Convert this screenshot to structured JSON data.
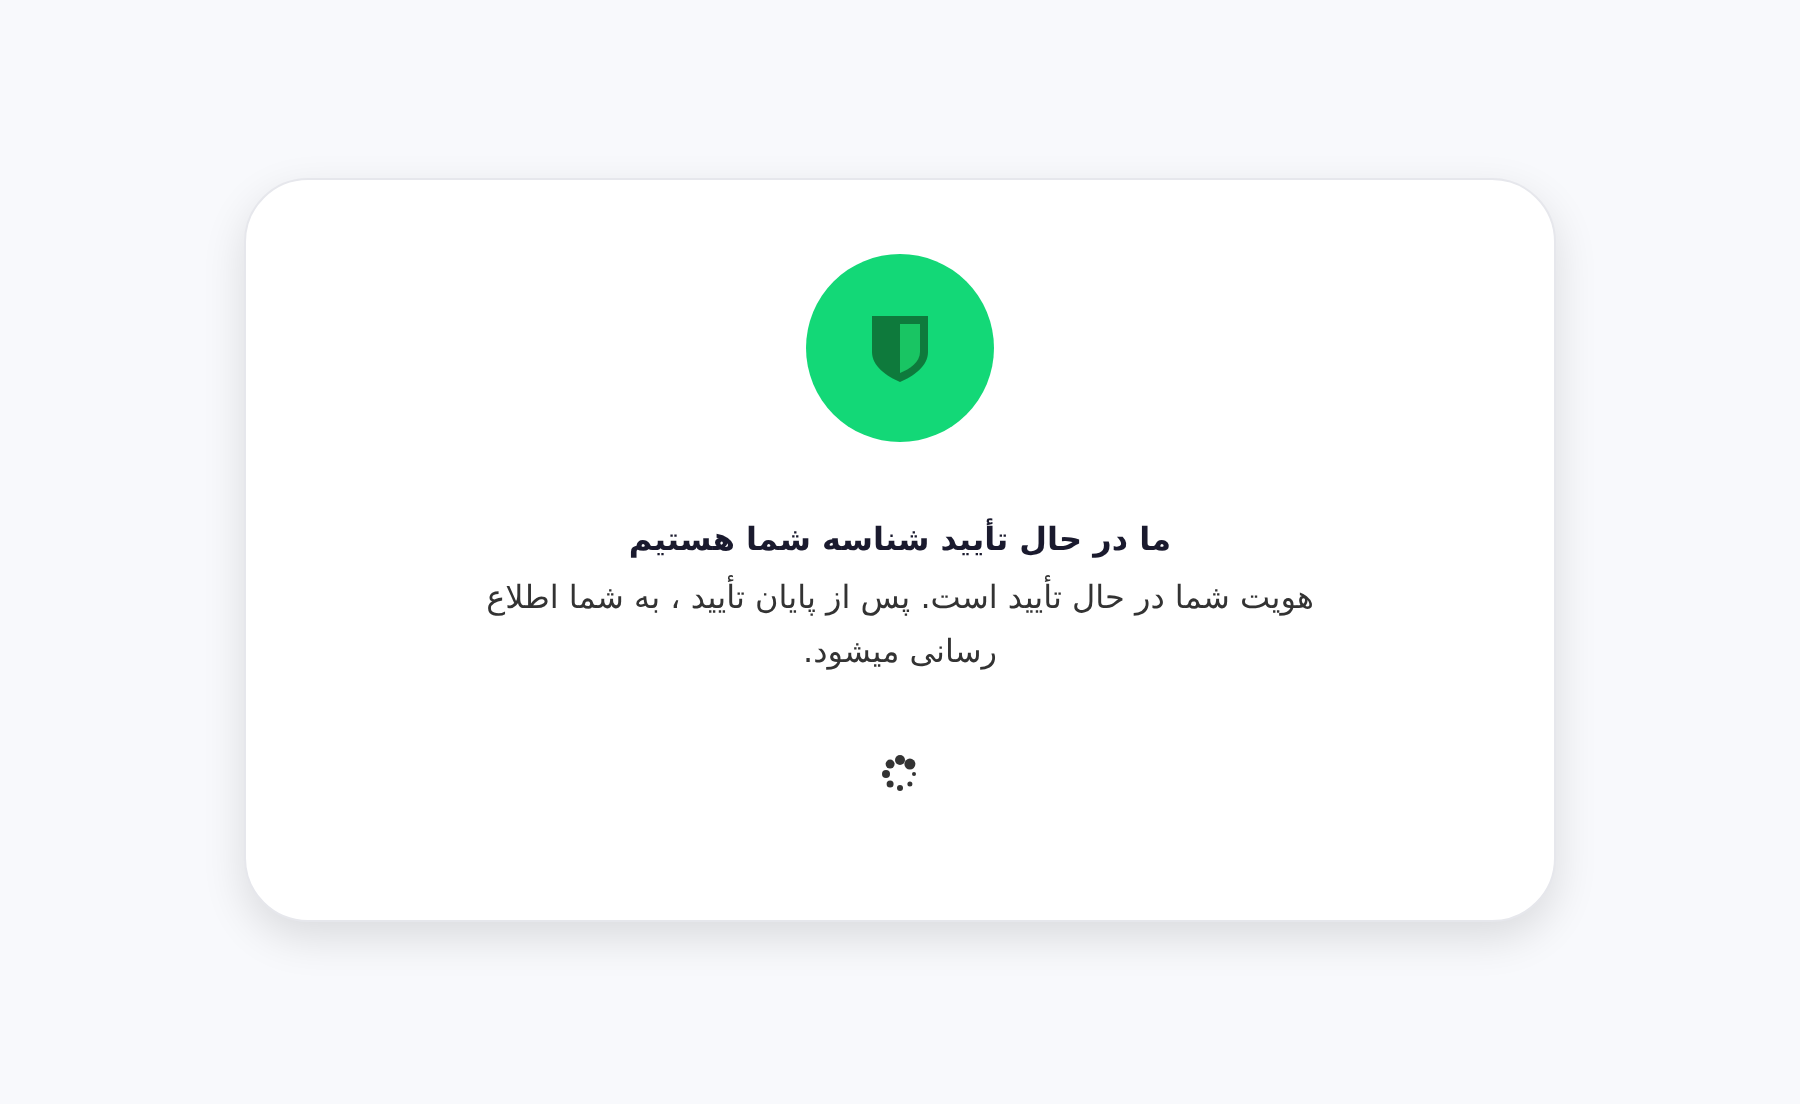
{
  "card": {
    "title": "ما در حال تأیید شناسه شما هستیم",
    "message": "هویت شما در حال تأیید است. پس از پایان تأیید ، به شما اطلاع رسانی میشود."
  }
}
